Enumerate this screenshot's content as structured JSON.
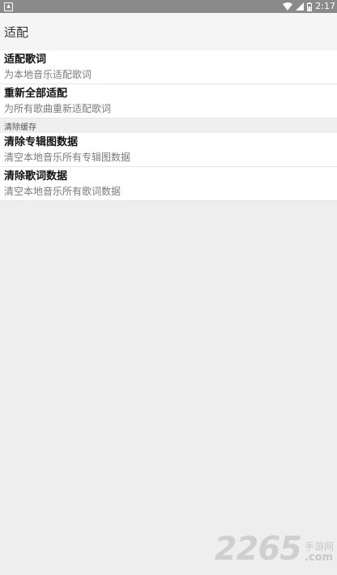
{
  "status_bar": {
    "time": "2:17",
    "icons": [
      "notification-icon",
      "wifi-icon",
      "signal-icon",
      "battery-icon"
    ]
  },
  "app_bar": {
    "title": "适配"
  },
  "sections": {
    "adapt_lyrics": {
      "title": "适配歌词",
      "summary": "为本地音乐适配歌词"
    },
    "readapt_all": {
      "title": "重新全部适配",
      "summary": "为所有歌曲重新适配歌词"
    },
    "cache_category": "清除缓存",
    "clear_album_art": {
      "title": "清除专辑图数据",
      "summary": "清空本地音乐所有专辑图数据"
    },
    "clear_lyrics": {
      "title": "清除歌词数据",
      "summary": "清空本地音乐所有歌词数据"
    }
  },
  "watermark": {
    "number": "2265",
    "cn": "手游网",
    "domain": ".com"
  },
  "colors": {
    "status_bar": "#8a8a8a",
    "background": "#eeeeee",
    "item_bg": "#ffffff"
  }
}
